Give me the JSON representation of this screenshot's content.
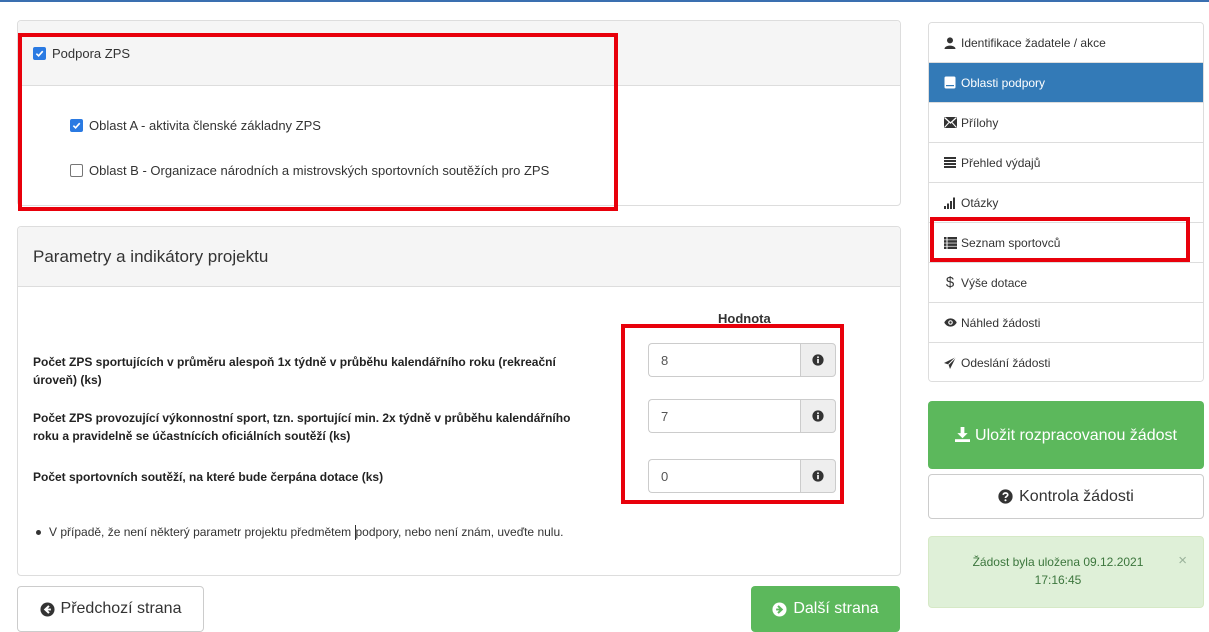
{
  "zps": {
    "main_checkbox": {
      "label": "Podpora ZPS",
      "checked": true
    },
    "areas": [
      {
        "label": "Oblast A - aktivita členské základny ZPS",
        "checked": true
      },
      {
        "label": "Oblast B - Organizace národních a mistrovských sportovních soutěžích pro ZPS",
        "checked": false
      }
    ]
  },
  "params": {
    "title": "Parametry a indikátory projektu",
    "value_column_header": "Hodnota",
    "rows": [
      {
        "label": "Počet ZPS sportujících v průměru alespoň 1x týdně v průběhu kalendářního roku (rekreační úroveň)  (ks)",
        "value": "8"
      },
      {
        "label": "Počet ZPS provozující výkonnostní sport, tzn. sportující min. 2x týdně v průběhu kalendářního roku a pravidelně se účastnících oficiálních soutěží  (ks)",
        "value": "7"
      },
      {
        "label": "Počet sportovních soutěží, na které bude čerpána dotace  (ks)",
        "value": "0"
      }
    ],
    "note_before": "V případě, že není některý parametr projektu předmětem ",
    "note_after": "podpory, nebo není znám, uveďte nulu."
  },
  "nav": {
    "prev_label": "Předchozí strana",
    "next_label": "Další strana"
  },
  "sidebar": {
    "items": [
      {
        "label": "Identifikace žadatele / akce",
        "icon": "user-icon"
      },
      {
        "label": "Oblasti podpory",
        "icon": "book-icon",
        "active": true
      },
      {
        "label": "Přílohy",
        "icon": "envelope-icon"
      },
      {
        "label": "Přehled výdajů",
        "icon": "list-icon"
      },
      {
        "label": "Otázky",
        "icon": "signal-icon"
      },
      {
        "label": "Seznam sportovců",
        "icon": "list-ul-icon"
      },
      {
        "label": "Výše dotace",
        "icon": "dollar-icon"
      },
      {
        "label": "Náhled žádosti",
        "icon": "eye-icon"
      },
      {
        "label": "Odeslání žádosti",
        "icon": "send-icon"
      }
    ]
  },
  "actions": {
    "save_label": "Uložit rozpracovanou žádost",
    "check_label": "Kontrola žádosti"
  },
  "alert": {
    "message": "Žádost byla uložena 09.12.2021 17:16:45",
    "close": "×"
  },
  "colors": {
    "primary": "#337ab7",
    "success": "#5cb85c",
    "highlight": "#e8000b",
    "alert_bg": "#dff0d8"
  }
}
